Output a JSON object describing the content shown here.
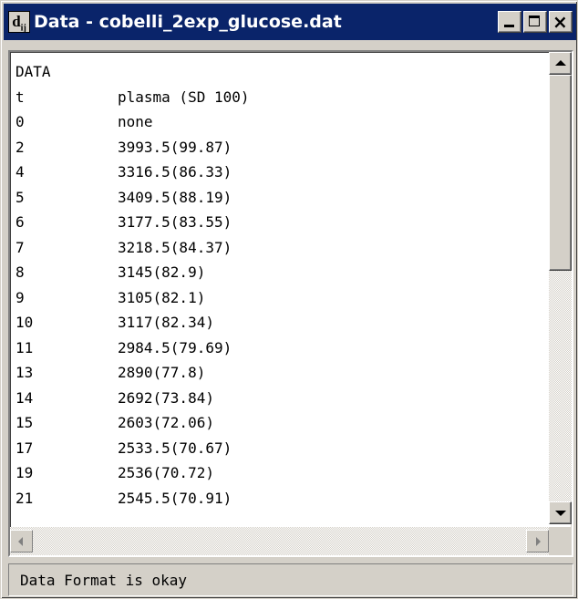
{
  "window": {
    "icon_label": "d",
    "icon_sub": "ij",
    "title": "Data - cobelli_2exp_glucose.dat"
  },
  "buttons": {
    "minimize": "minimize",
    "maximize": "maximize",
    "close": "×"
  },
  "content": {
    "header_line": "DATA",
    "column_header": {
      "t": "t",
      "value": "plasma (SD 100)"
    },
    "rows": [
      {
        "t": "0",
        "value": "none"
      },
      {
        "t": "2",
        "value": "3993.5(99.87)"
      },
      {
        "t": "4",
        "value": "3316.5(86.33)"
      },
      {
        "t": "5",
        "value": "3409.5(88.19)"
      },
      {
        "t": "6",
        "value": "3177.5(83.55)"
      },
      {
        "t": "7",
        "value": "3218.5(84.37)"
      },
      {
        "t": "8",
        "value": "3145(82.9)"
      },
      {
        "t": "9",
        "value": "3105(82.1)"
      },
      {
        "t": "10",
        "value": "3117(82.34)"
      },
      {
        "t": "11",
        "value": "2984.5(79.69)"
      },
      {
        "t": "13",
        "value": "2890(77.8)"
      },
      {
        "t": "14",
        "value": "2692(73.84)"
      },
      {
        "t": "15",
        "value": "2603(72.06)"
      },
      {
        "t": "17",
        "value": "2533.5(70.67)"
      },
      {
        "t": "19",
        "value": "2536(70.72)"
      },
      {
        "t": "21",
        "value": "2545.5(70.91)"
      }
    ]
  },
  "status": {
    "text": "Data Format is okay"
  },
  "colors": {
    "titlebar": "#0a246a",
    "face": "#d4d0c8"
  }
}
